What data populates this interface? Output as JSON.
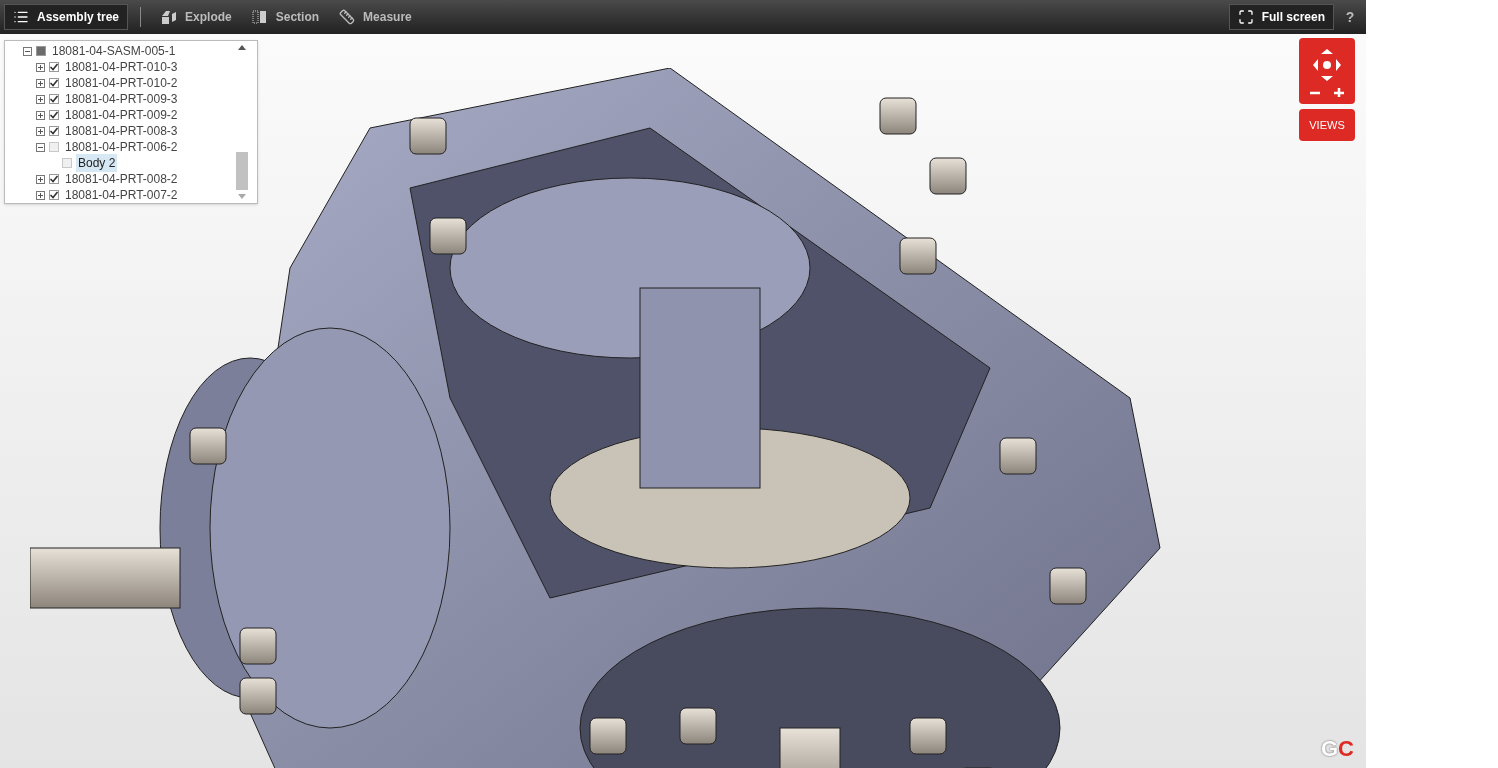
{
  "toolbar": {
    "items": [
      {
        "kind": "tree",
        "label": "Assembly tree",
        "selected": true
      },
      {
        "kind": "explode",
        "label": "Explode",
        "selected": false
      },
      {
        "kind": "section",
        "label": "Section",
        "selected": false
      },
      {
        "kind": "measure",
        "label": "Measure",
        "selected": false
      }
    ],
    "fullscreen": {
      "label": "Full screen"
    },
    "help": {
      "label": "?"
    }
  },
  "tree": {
    "items": [
      {
        "label": "18081-04-SASM-005-1",
        "checked": false,
        "partial": true,
        "expanded": true,
        "selected": false,
        "children": [
          {
            "label": "18081-04-PRT-010-3",
            "checked": true,
            "expanded": false,
            "selected": false
          },
          {
            "label": "18081-04-PRT-010-2",
            "checked": true,
            "expanded": false,
            "selected": false
          },
          {
            "label": "18081-04-PRT-009-3",
            "checked": true,
            "expanded": false,
            "selected": false
          },
          {
            "label": "18081-04-PRT-009-2",
            "checked": true,
            "expanded": false,
            "selected": false
          },
          {
            "label": "18081-04-PRT-008-3",
            "checked": true,
            "expanded": false,
            "selected": false
          },
          {
            "label": "18081-04-PRT-006-2",
            "checked": false,
            "expanded": true,
            "selected": false,
            "children": [
              {
                "label": "Body 2",
                "checked": false,
                "selected": true
              }
            ]
          },
          {
            "label": "18081-04-PRT-008-2",
            "checked": true,
            "expanded": false,
            "selected": false
          },
          {
            "label": "18081-04-PRT-007-2",
            "checked": true,
            "expanded": false,
            "selected": false
          }
        ]
      }
    ]
  },
  "views_button": {
    "label": "VIEWS"
  },
  "logo": {
    "first": "G",
    "second": "C"
  }
}
